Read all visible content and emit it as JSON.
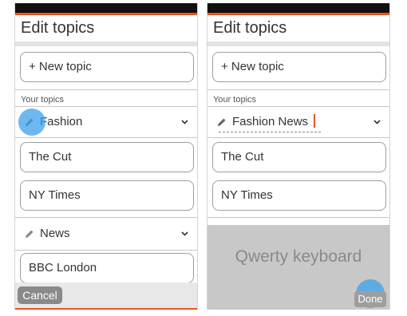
{
  "header": {
    "title": "Edit topics"
  },
  "new_topic_label": "+ New topic",
  "section_label": "Your topics",
  "left_screen": {
    "topic_1": "Fashion",
    "feeds_1": [
      "The Cut",
      "NY Times"
    ],
    "topic_2": "News",
    "feeds_2": [
      "BBC London"
    ],
    "cancel_label": "Cancel"
  },
  "right_screen": {
    "editing_topic_value": "Fashion News",
    "feeds": [
      "The Cut",
      "NY Times"
    ],
    "keyboard_label": "Qwerty keyboard",
    "done_label": "Done"
  },
  "colors": {
    "accent": "#e95420",
    "touch": "#3ca0eb"
  }
}
